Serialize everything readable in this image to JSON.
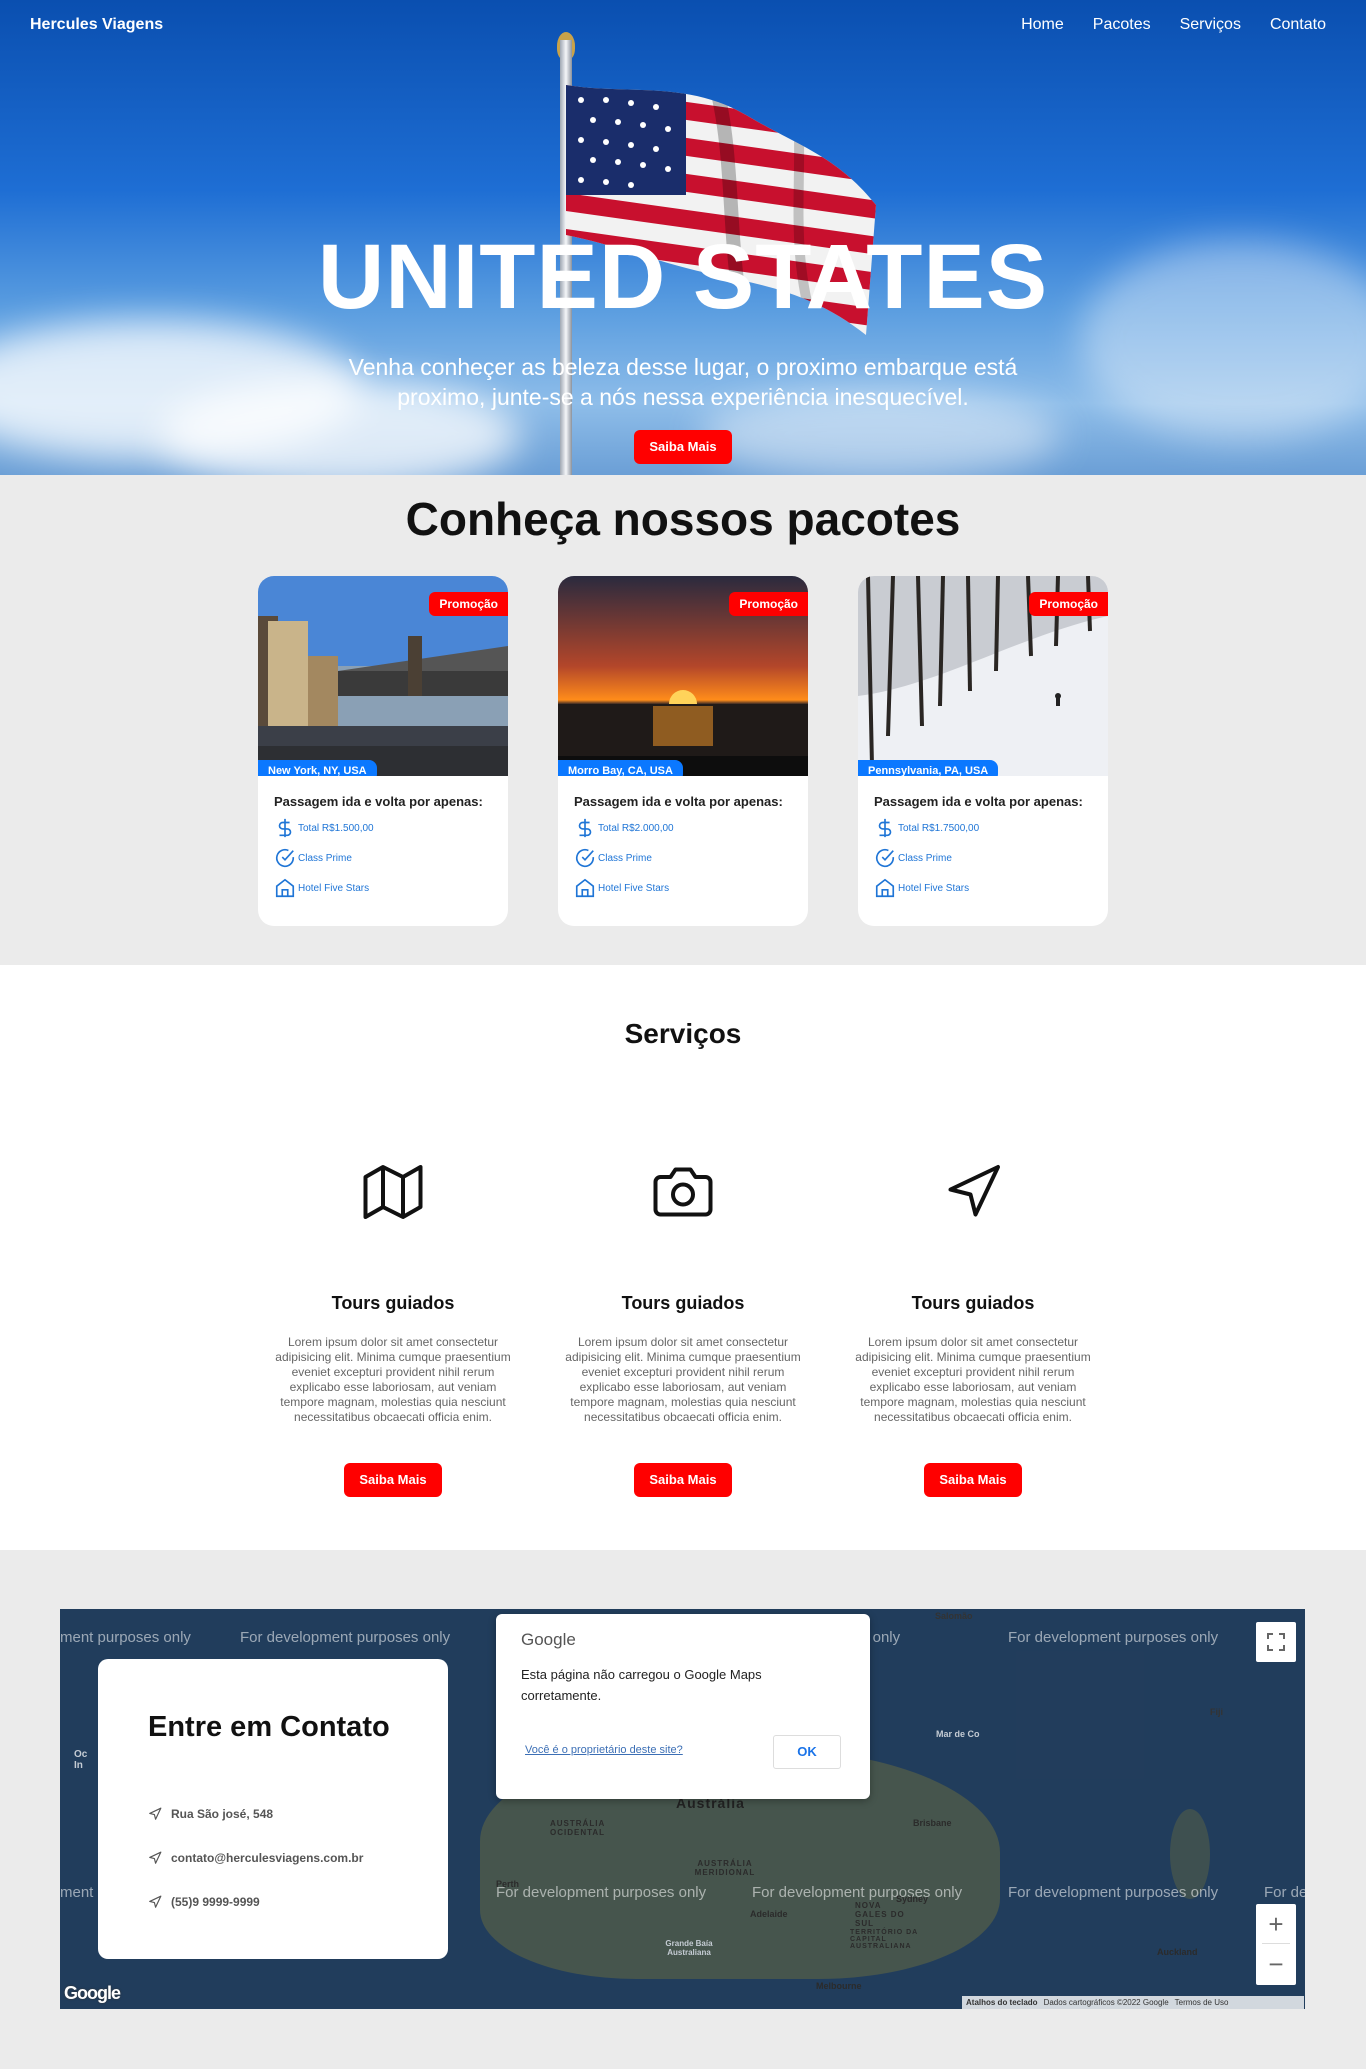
{
  "nav": {
    "brand": "Hercules Viagens",
    "links": [
      "Home",
      "Pacotes",
      "Serviços",
      "Contato"
    ]
  },
  "hero": {
    "title": "UNITED STATES",
    "subtitle": "Venha conheçer as beleza desse lugar, o proximo embarque está proximo, junte-se a nós nessa experiência inesquecível.",
    "button": "Saiba Mais"
  },
  "packages": {
    "title": "Conheça nossos pacotes",
    "cards": [
      {
        "badge": "Promoção",
        "location": "New York, NY, USA",
        "headline": "Passagem ida e volta por apenas:",
        "price": "Total R$1.500,00",
        "class": "Class Prime",
        "hotel": "Hotel Five Stars"
      },
      {
        "badge": "Promoção",
        "location": "Morro Bay, CA, USA",
        "headline": "Passagem ida e volta por apenas:",
        "price": "Total R$2.000,00",
        "class": "Class Prime",
        "hotel": "Hotel Five Stars"
      },
      {
        "badge": "Promoção",
        "location": "Pennsylvania, PA, USA",
        "headline": "Passagem ida e volta por apenas:",
        "price": "Total R$1.7500,00",
        "class": "Class Prime",
        "hotel": "Hotel Five Stars"
      }
    ]
  },
  "services": {
    "title": "Serviços",
    "items": [
      {
        "icon": "map-icon",
        "title": "Tours guiados",
        "text": "Lorem ipsum dolor sit amet consectetur adipisicing elit. Minima cumque praesentium eveniet excepturi provident nihil rerum explicabo esse laboriosam, aut veniam tempore magnam, molestias quia nesciunt necessitatibus obcaecati officia enim.",
        "button": "Saiba Mais"
      },
      {
        "icon": "camera-icon",
        "title": "Tours guiados",
        "text": "Lorem ipsum dolor sit amet consectetur adipisicing elit. Minima cumque praesentium eveniet excepturi provident nihil rerum explicabo esse laboriosam, aut veniam tempore magnam, molestias quia nesciunt necessitatibus obcaecati officia enim.",
        "button": "Saiba Mais"
      },
      {
        "icon": "navigation-icon",
        "title": "Tours guiados",
        "text": "Lorem ipsum dolor sit amet consectetur adipisicing elit. Minima cumque praesentium eveniet excepturi provident nihil rerum explicabo esse laboriosam, aut veniam tempore magnam, molestias quia nesciunt necessitatibus obcaecati officia enim.",
        "button": "Saiba Mais"
      }
    ]
  },
  "contact": {
    "title": "Entre em Contato",
    "address": "Rua São josé, 548",
    "email": "contato@herculesviagens.com.br",
    "phone": "(55)9 9999-9999"
  },
  "map": {
    "watermark": "For development purposes only",
    "watermark_partial_left": "ment purposes only",
    "watermark_partial_right": "For de",
    "dialog_brand": "Google",
    "dialog_message": "Esta página não carregou o Google Maps corretamente.",
    "dialog_owner_link": "Você é o proprietário deste site?",
    "dialog_ok": "OK",
    "labels": {
      "australia": "Austrália",
      "west": "AUSTRÁLIA OCIDENTAL",
      "south": "AUSTRÁLIA MERIDIONAL",
      "nsw": "NOVA GALES DO SUL",
      "act": "TERRITÓRIO DA CAPITAL AUSTRALIANA",
      "brisbane": "Brisbane",
      "sydney": "Sydney",
      "perth": "Perth",
      "adelaide": "Adelaide",
      "melbourne": "Melbourne",
      "auckland": "Auckland",
      "bight": "Grande Baía Australiana",
      "coral": "Mar de Co",
      "fiji": "Fiji",
      "solomon": "Salomão",
      "indian_ocean": "Oc In"
    },
    "attribution": [
      "Atalhos do teclado",
      "Dados cartográficos ©2022 Google",
      "Termos de Uso"
    ],
    "logo": "Google",
    "zoom_in": "+",
    "zoom_out": "−"
  },
  "colors": {
    "accent_red": "#ff0000",
    "accent_blue": "#0b78ff",
    "link_blue": "#1f75d6"
  }
}
